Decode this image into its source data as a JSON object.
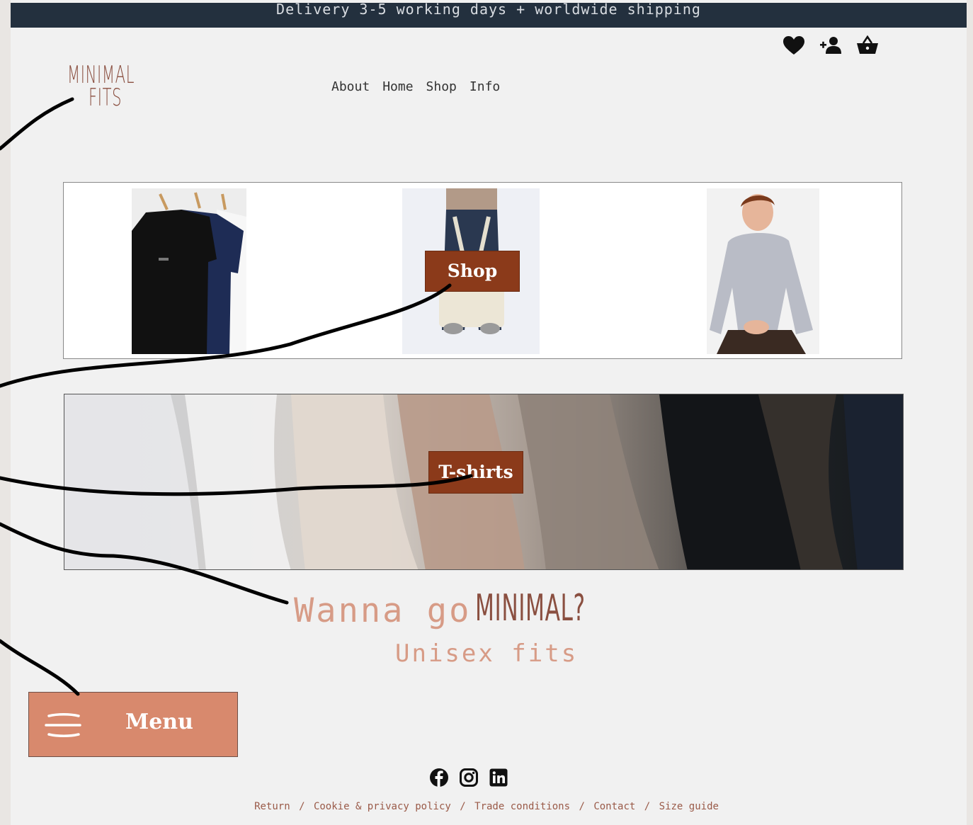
{
  "announcement": "Delivery 3-5 working days + worldwide shipping",
  "logo": {
    "line1": "MINIMAL",
    "line2": "FITS"
  },
  "nav": [
    "About",
    "Home",
    "Shop",
    "Info"
  ],
  "header_icons": [
    "heart-icon",
    "add-user-icon",
    "basket-icon"
  ],
  "gallery": {
    "shop_label": "Shop"
  },
  "banner": {
    "tshirts_label": "T-shirts"
  },
  "tagline": {
    "prefix": "Wanna go",
    "brand": "MINIMAL?",
    "sub": "Unisex fits"
  },
  "menu": {
    "label": "Menu"
  },
  "social": [
    "facebook-icon",
    "instagram-icon",
    "linkedin-icon"
  ],
  "footer": [
    "Return",
    "Cookie & privacy policy",
    "Trade conditions",
    "Contact",
    "Size guide"
  ],
  "colors": {
    "accent": "#8b3a1a",
    "menu": "#d8896d",
    "topbar": "#23303e",
    "tagline": "#d79b86"
  }
}
